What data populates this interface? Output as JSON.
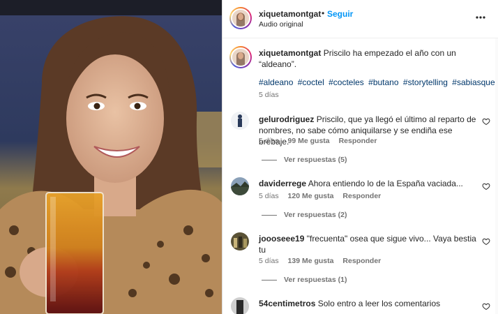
{
  "header": {
    "username": "xiquetamontgat",
    "separator": "•",
    "follow_label": "Seguir",
    "subtitle": "Audio original",
    "more_icon": "more-horizontal-icon"
  },
  "caption": {
    "username": "xiquetamontgat",
    "text": "Priscilo ha empezado el año con un “aldeano”.",
    "hashtags": [
      "#aldeano",
      "#coctel",
      "#cocteles",
      "#butano",
      "#storytelling",
      "#sabiasque"
    ],
    "time": "5 días"
  },
  "comments": [
    {
      "username": "gelurodriguez",
      "text": "Priscilo, que ya llegó el último al reparto de nombres, no sabe cómo aniquilarse y se endiña ese brebaje.",
      "time": "5 días",
      "likes": "99 Me gusta",
      "reply": "Responder",
      "replies": "Ver respuestas (5)"
    },
    {
      "username": "daviderrege",
      "text": "Ahora entiendo lo de la España vaciada...",
      "time": "5 días",
      "likes": "120 Me gusta",
      "reply": "Responder",
      "replies": "Ver respuestas (2)"
    },
    {
      "username": "joooseee19",
      "text": "\"frecuenta\" osea que sigue vivo... Vaya bestia tu",
      "time": "5 días",
      "likes": "139 Me gusta",
      "reply": "Responder",
      "replies": "Ver respuestas (1)"
    },
    {
      "username": "54centimetros",
      "text": "Solo entro a leer los comentarios"
    }
  ],
  "colors": {
    "link_blue": "#0095f6",
    "hashtag": "#00376b",
    "muted": "#737373"
  }
}
